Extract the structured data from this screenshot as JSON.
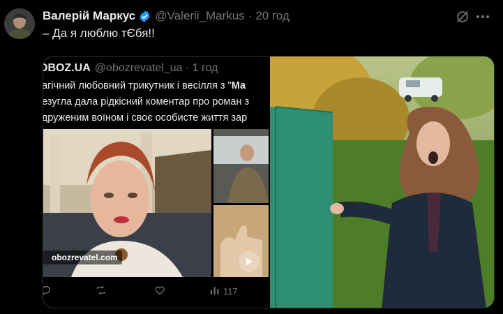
{
  "author": {
    "name": "Валерій Маркус",
    "handle": "@Valerii_Markus",
    "separator": "·",
    "time": "20 год"
  },
  "tweet_text": "– Да я люблю тЄбя!!",
  "quoted": {
    "source": "OBOZ.UA",
    "handle": "@obozrevatel_ua",
    "separator": "·",
    "time": "1 год",
    "line1_prefix": "рагічний любовний трикутник і весілля з \"",
    "line1_bold": "Ма",
    "line2": "безугла дала рідкісний коментар про роман з",
    "line3": "одруженим воїном і своє особисте життя зар",
    "watermark": "obozrevatel.com",
    "views": "117"
  },
  "colors": {
    "bg": "#000000",
    "text": "#e7e9ea",
    "muted": "#71767b",
    "verified": "#1d9bf0"
  },
  "icons": [
    "verified-badge-icon",
    "grok-icon",
    "more-icon",
    "reply-icon",
    "retweet-icon",
    "like-icon",
    "views-icon",
    "play-icon"
  ]
}
